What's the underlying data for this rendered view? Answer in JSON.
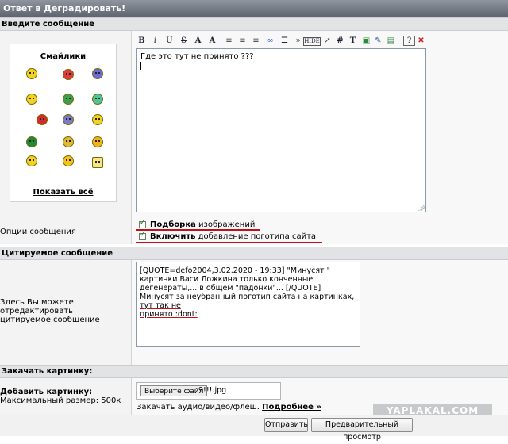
{
  "window": {
    "title": "Ответ в Деградировать!"
  },
  "sections": {
    "message": "Введите сообщение",
    "quoted": "Цитируемое сообщение",
    "upload": "Закачать картинку:"
  },
  "smileys": {
    "title": "Смайлики",
    "show_all": "Показать всё",
    "items": [
      "smile-icon",
      "angry-icon",
      "cool-icon",
      "confused-icon",
      "thumbs-up-icon",
      "wink-icon",
      "devil-icon",
      "alien-icon",
      "blush-icon",
      "gun-icon",
      "cry-icon",
      "dance-icon",
      "teeth-icon",
      "rock-icon",
      "love-icon",
      "beer-icon",
      "scared-icon",
      "star-icon"
    ]
  },
  "toolbar": {
    "buttons": [
      "B",
      "i",
      "U",
      "S",
      "A",
      "A",
      "≡",
      "≡",
      "≡",
      "∞",
      "☰",
      "»",
      "HIDE",
      "↗",
      "#",
      "T",
      "▣",
      "✎",
      "▤",
      "?",
      "✕"
    ]
  },
  "editor": {
    "text": "Где это тут не принято ???"
  },
  "options": {
    "label": "Опции сообщения",
    "opt1_bold": "Подборка",
    "opt1_rest": " изображений",
    "opt2_bold": "Включить",
    "opt2_rest": " добавление поготипа сайта"
  },
  "quote": {
    "label": "Здесь Вы можете отредактировать цитируемое сообщение",
    "line1": "[QUOTE=defo2004,3.02.2020 - 19:33] \"Минусят \" картинки Васи Ложкина только конченные дегенераты,... в общем \"падонки\"... [/QUOTE]",
    "line2_a": "Минусят за неубранный поготип сайта на картинках, ",
    "line2_b": "тут так не",
    "line3": "принято :dont:"
  },
  "upload": {
    "label": "Добавить картинку:",
    "max": "Максимальный размер: 500к",
    "button": "Выберите файл",
    "filename": "9!!!.jpg",
    "audio_text": "Закачать аудио/видео/флеш. ",
    "audio_more": "Подробнее »"
  },
  "buttons": {
    "submit": "Отправить",
    "preview": "Предварительный просмотр"
  },
  "watermark": "YAPLAKAL.COM",
  "colors": {
    "annotation": "#c0101a",
    "header": "#e1e3e5"
  }
}
